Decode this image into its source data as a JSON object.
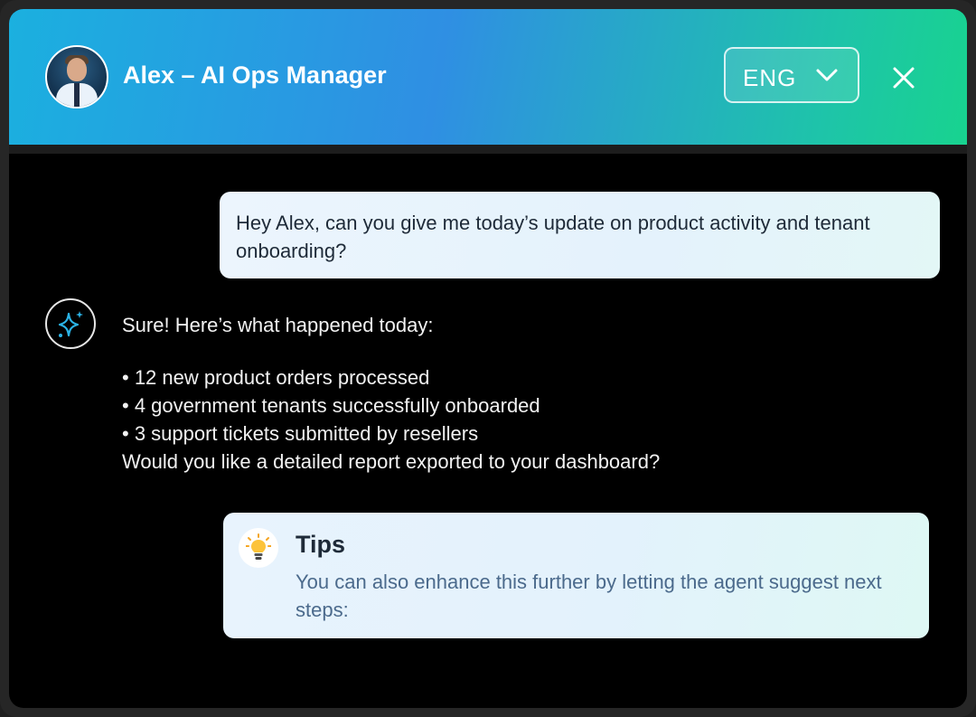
{
  "header": {
    "title": "Alex – AI Ops Manager",
    "language_selected": "ENG",
    "avatar_icon": "avatar-portrait",
    "close_icon": "close-icon",
    "chevron_icon": "chevron-down-icon",
    "gradient_colors": [
      "#1bb0df",
      "#2f8fe3",
      "#18d38f"
    ]
  },
  "conversation": {
    "user_message": "Hey Alex, can you give me today’s update on product activity and tenant onboarding?",
    "assistant": {
      "icon": "sparkles-icon",
      "intro": "Sure! Here’s what happened today:",
      "bullets": [
        "• 12 new product orders processed",
        "• 4 government tenants successfully onboarded",
        "• 3 support tickets submitted by resellers"
      ],
      "closing": "Would you like a detailed report exported to your dashboard?"
    }
  },
  "tips": {
    "icon": "lightbulb-icon",
    "title": "Tips",
    "body": "You can also enhance this further by letting the agent suggest next steps:"
  },
  "colors": {
    "background": "#000000",
    "bubble": "#e6f3fc",
    "tips_text": "#4b6a8c",
    "sparkle": "#2bb3e6"
  }
}
